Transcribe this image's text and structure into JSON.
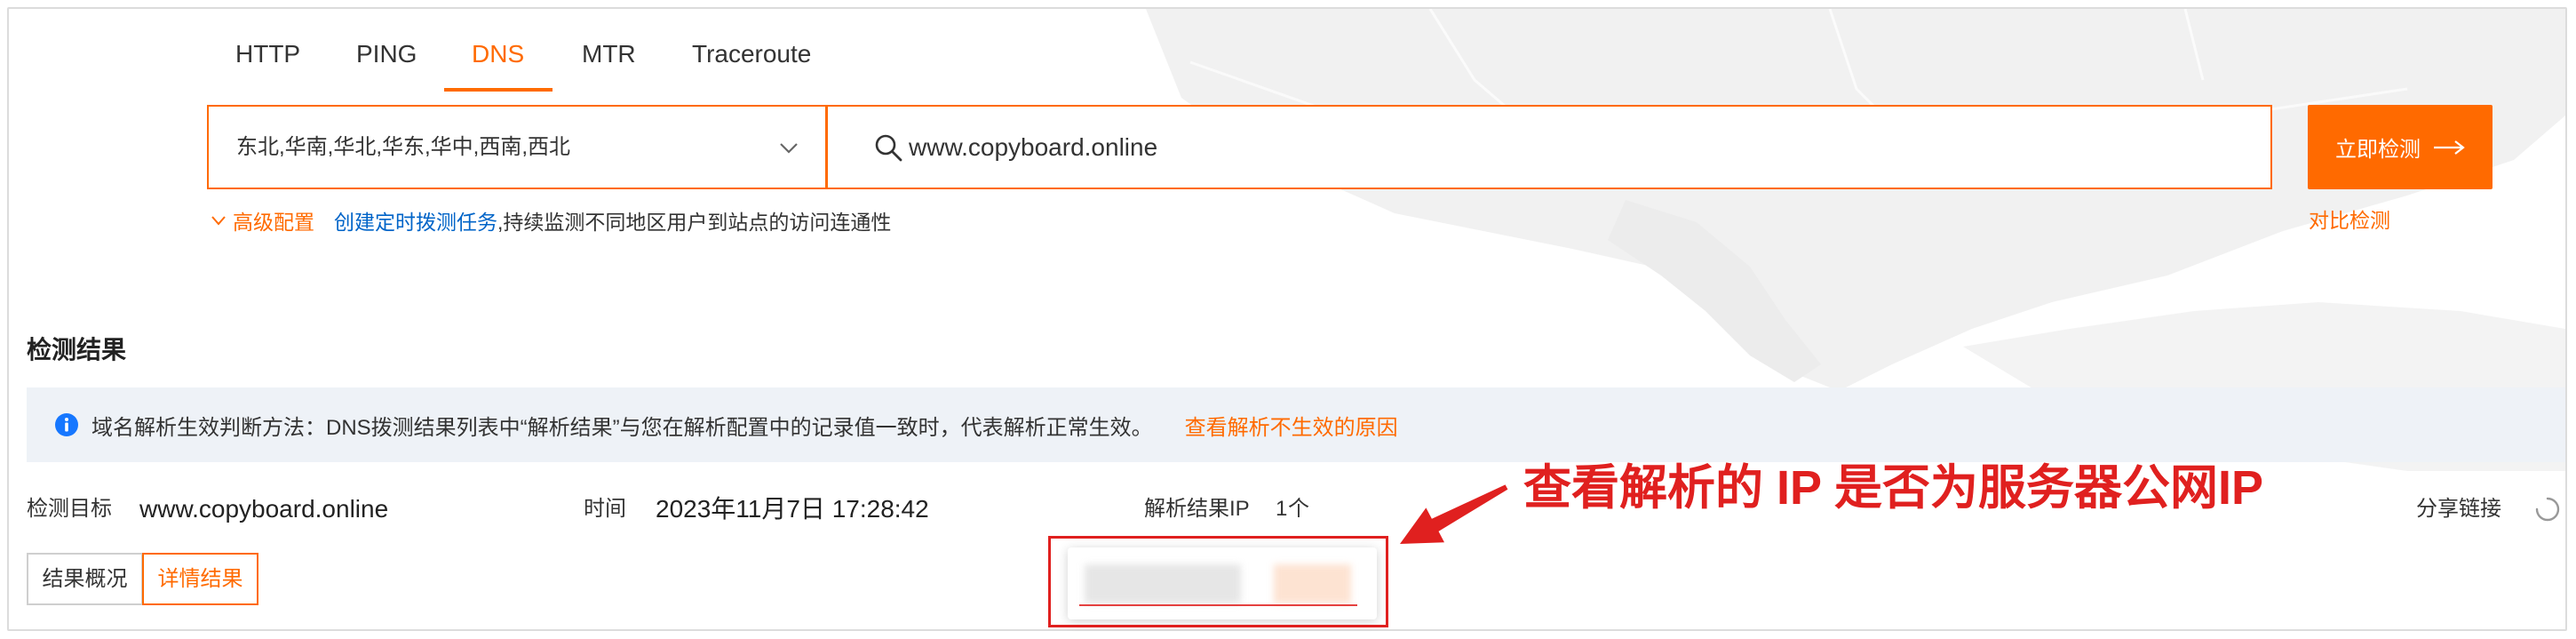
{
  "tabs": [
    {
      "label": "HTTP"
    },
    {
      "label": "PING"
    },
    {
      "label": "DNS"
    },
    {
      "label": "MTR"
    },
    {
      "label": "Traceroute"
    }
  ],
  "active_tab": "DNS",
  "form": {
    "regions_value": "东北,华南,华北,华东,华中,西南,西北",
    "target_value": "www.copyboard.online",
    "submit_label": "立即检测",
    "advanced_label": "高级配置",
    "create_task_link": "创建定时拨测任务",
    "create_task_suffix": ",持续监测不同地区用户到站点的访问连通性",
    "compare_link": "对比检测"
  },
  "results": {
    "title": "检测结果",
    "info_text": "域名解析生效判断方法：DNS拨测结果列表中“解析结果”与您在解析配置中的记录值一致时，代表解析正常生效。",
    "info_link": "查看解析不生效的原因",
    "target_label": "检测目标",
    "target_value": "www.copyboard.online",
    "time_label": "时间",
    "time_value": "2023年11月7日 17:28:42",
    "ip_label": "解析结果IP",
    "ip_count": "1",
    "ip_unit": "个",
    "share_label": "分享链接",
    "view_tabs": [
      {
        "label": "结果概况"
      },
      {
        "label": "详情结果"
      }
    ],
    "active_view_tab": "详情结果"
  },
  "annotation": {
    "text": "查看解析的 IP 是否为服务器公网IP"
  },
  "icons": {
    "region_dropdown": "chevron-down-icon",
    "search": "search-icon",
    "submit_arrow": "arrow-right-icon",
    "advanced_toggle": "chevron-down-icon",
    "info": "info-icon",
    "loading": "loading-icon",
    "annotation_arrow": "arrow-icon"
  },
  "colors": {
    "accent": "#ff6a00",
    "link": "#0064c8",
    "info_icon": "#1677ff",
    "info_bg": "#eef2f7",
    "annotation": "#e0201f"
  }
}
